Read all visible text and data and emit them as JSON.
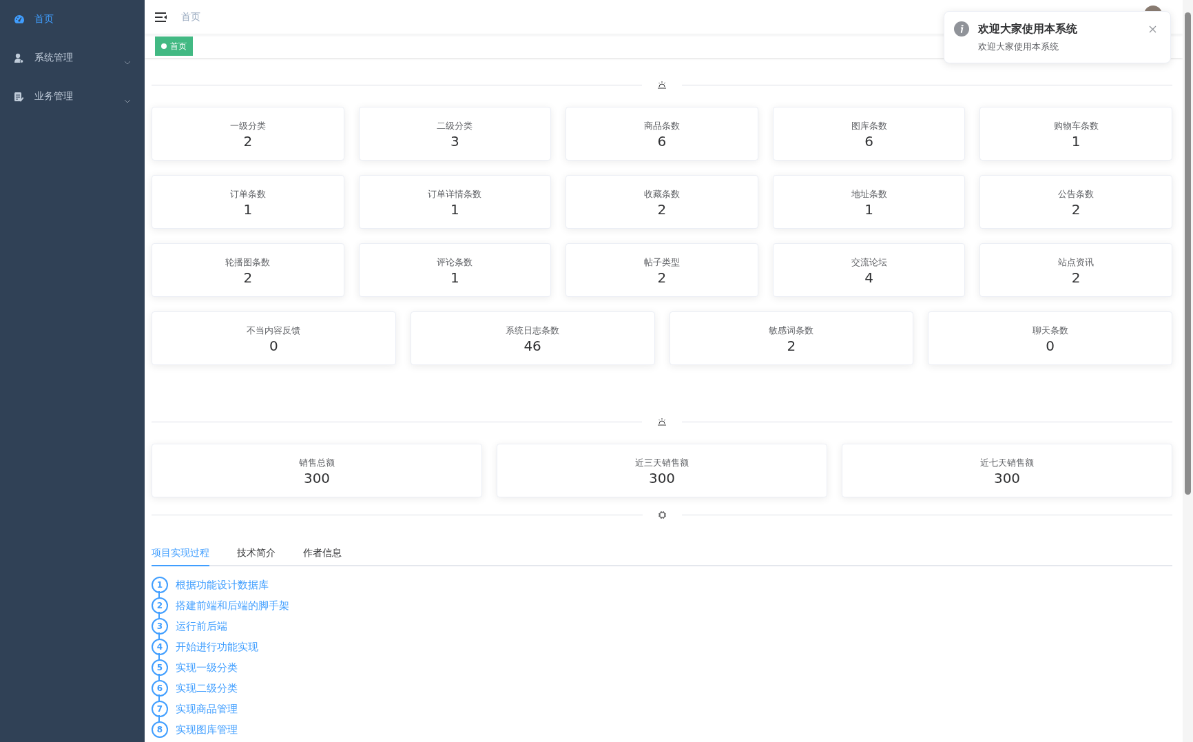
{
  "sidebar": {
    "items": [
      {
        "label": "首页",
        "selected": true,
        "expandable": false
      },
      {
        "label": "系统管理",
        "selected": false,
        "expandable": true
      },
      {
        "label": "业务管理",
        "selected": false,
        "expandable": true
      }
    ]
  },
  "header": {
    "breadcrumb": "首页"
  },
  "tags": [
    {
      "label": "首页",
      "selected": true
    }
  ],
  "notification": {
    "title": "欢迎大家使用本系统",
    "message": "欢迎大家使用本系统"
  },
  "count_rows": [
    [
      {
        "label": "一级分类",
        "value": "2"
      },
      {
        "label": "二级分类",
        "value": "3"
      },
      {
        "label": "商品条数",
        "value": "6"
      },
      {
        "label": "图库条数",
        "value": "6"
      },
      {
        "label": "购物车条数",
        "value": "1"
      }
    ],
    [
      {
        "label": "订单条数",
        "value": "1"
      },
      {
        "label": "订单详情条数",
        "value": "1"
      },
      {
        "label": "收藏条数",
        "value": "2"
      },
      {
        "label": "地址条数",
        "value": "1"
      },
      {
        "label": "公告条数",
        "value": "2"
      }
    ],
    [
      {
        "label": "轮播图条数",
        "value": "2"
      },
      {
        "label": "评论条数",
        "value": "1"
      },
      {
        "label": "帖子类型",
        "value": "2"
      },
      {
        "label": "交流论坛",
        "value": "4"
      },
      {
        "label": "站点资讯",
        "value": "2"
      }
    ],
    [
      {
        "label": "不当内容反馈",
        "value": "0"
      },
      {
        "label": "系统日志条数",
        "value": "46"
      },
      {
        "label": "敏感词条数",
        "value": "2"
      },
      {
        "label": "聊天条数",
        "value": "0"
      }
    ]
  ],
  "sales": [
    {
      "label": "销售总额",
      "value": "300"
    },
    {
      "label": "近三天销售额",
      "value": "300"
    },
    {
      "label": "近七天销售额",
      "value": "300"
    }
  ],
  "tabs": [
    {
      "label": "项目实现过程",
      "selected": true
    },
    {
      "label": "技术简介",
      "selected": false
    },
    {
      "label": "作者信息",
      "selected": false
    }
  ],
  "steps": [
    {
      "number": "1",
      "text": "根据功能设计数据库"
    },
    {
      "number": "2",
      "text": "搭建前端和后端的脚手架"
    },
    {
      "number": "3",
      "text": "运行前后端"
    },
    {
      "number": "4",
      "text": "开始进行功能实现"
    },
    {
      "number": "5",
      "text": "实现一级分类"
    },
    {
      "number": "6",
      "text": "实现二级分类"
    },
    {
      "number": "7",
      "text": "实现商品管理"
    },
    {
      "number": "8",
      "text": "实现图库管理"
    }
  ]
}
